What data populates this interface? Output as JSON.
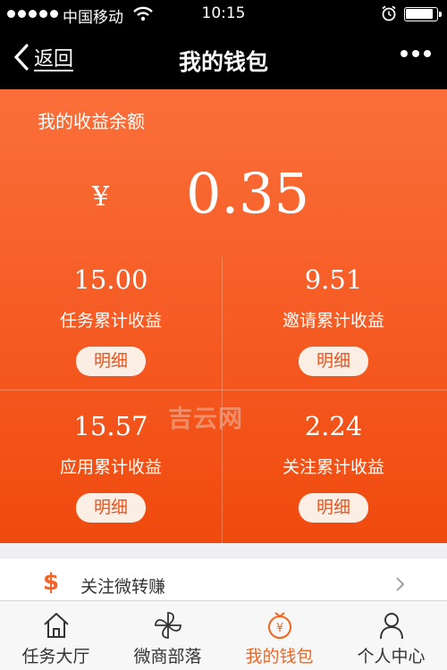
{
  "status_bar": {
    "carrier": "中国移动",
    "time": "10:15",
    "battery_level": 0.9
  },
  "nav": {
    "back_label": "返回",
    "title": "我的钱包"
  },
  "wallet": {
    "balance_label": "我的收益余额",
    "currency": "¥",
    "balance": "0.35",
    "stats": [
      {
        "value": "15.00",
        "label": "任务累计收益",
        "button": "明细"
      },
      {
        "value": "9.51",
        "label": "邀请累计收益",
        "button": "明细"
      },
      {
        "value": "15.57",
        "label": "应用累计收益",
        "button": "明细"
      },
      {
        "value": "2.24",
        "label": "关注累计收益",
        "button": "明细"
      }
    ]
  },
  "watermark": "吉云网",
  "list": {
    "icon": "$",
    "label": "关注微转赚"
  },
  "tabs": [
    {
      "label": "任务大厅",
      "icon": "home-icon"
    },
    {
      "label": "微商部落",
      "icon": "pinwheel-icon"
    },
    {
      "label": "我的钱包",
      "icon": "wallet-icon",
      "active": true
    },
    {
      "label": "个人中心",
      "icon": "person-icon"
    }
  ],
  "colors": {
    "accent": "#f0651f",
    "card_top": "#fb6f3a",
    "card_bottom": "#f04a0e"
  }
}
